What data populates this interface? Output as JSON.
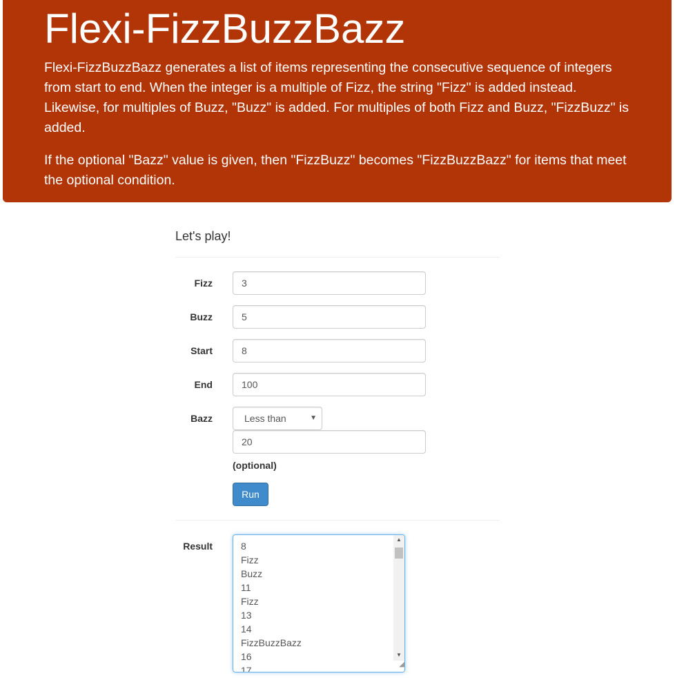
{
  "header": {
    "title": "Flexi-FizzBuzzBazz",
    "paragraph1": "Flexi-FizzBuzzBazz generates a list of items representing the consecutive sequence of integers from start to end. When the integer is a multiple of Fizz, the string \"Fizz\" is added instead. Likewise, for multiples of Buzz, \"Buzz\" is added. For multiples of both Fizz and Buzz, \"FizzBuzz\" is added.",
    "paragraph2": "If the optional \"Bazz\" value is given, then \"FizzBuzz\" becomes \"FizzBuzzBazz\" for items that meet the optional condition.",
    "color": "#b23508"
  },
  "form": {
    "lead": "Let's play!",
    "fizz": {
      "label": "Fizz",
      "value": "3"
    },
    "buzz": {
      "label": "Buzz",
      "value": "5"
    },
    "start": {
      "label": "Start",
      "value": "8"
    },
    "end": {
      "label": "End",
      "value": "100"
    },
    "bazz": {
      "label": "Bazz",
      "operator": "Less than",
      "value": "20",
      "hint": "(optional)"
    },
    "run_label": "Run"
  },
  "result": {
    "label": "Result",
    "lines": [
      "8",
      "Fizz",
      "Buzz",
      "11",
      "Fizz",
      "13",
      "14",
      "FizzBuzzBazz",
      "16",
      "17"
    ]
  }
}
